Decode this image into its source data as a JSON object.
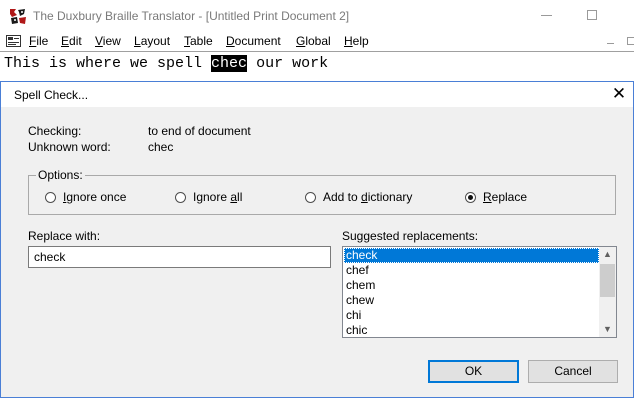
{
  "window": {
    "title": "The Duxbury Braille Translator - [Untitled Print Document 2]"
  },
  "menu": [
    {
      "label": "File",
      "underline": "F",
      "rest": "ile"
    },
    {
      "label": "Edit",
      "underline": "E",
      "rest": "dit"
    },
    {
      "label": "View",
      "underline": "V",
      "rest": "iew"
    },
    {
      "label": "Layout",
      "underline": "L",
      "rest": "ayout"
    },
    {
      "label": "Table",
      "underline": "T",
      "rest": "able"
    },
    {
      "label": "Document",
      "underline": "D",
      "rest": "ocument"
    },
    {
      "label": "Global",
      "underline": "G",
      "rest": "lobal"
    },
    {
      "label": "Help",
      "underline": "H",
      "rest": "elp"
    }
  ],
  "document": {
    "before": "This is where we spell ",
    "highlighted": "chec",
    "after": " our work"
  },
  "dialog": {
    "title": "Spell Check...",
    "checking_label": "Checking:",
    "checking_value": "to end of document",
    "unknown_label": "Unknown word:",
    "unknown_value": "chec",
    "options_label": "Options:",
    "options": [
      {
        "pre": "",
        "key": "I",
        "post": "gnore once",
        "checked": false
      },
      {
        "pre": "Ignore ",
        "key": "a",
        "post": "ll",
        "checked": false
      },
      {
        "pre": "Add to ",
        "key": "d",
        "post": "ictionary",
        "checked": false
      },
      {
        "pre": "",
        "key": "R",
        "post": "eplace",
        "checked": true
      }
    ],
    "replace_with_label": "Replace with:",
    "replace_with_value": "check",
    "suggested_label": "Suggested replacements:",
    "suggestions": [
      "check",
      "chef",
      "chem",
      "chew",
      "chi",
      "chic"
    ],
    "selected_suggestion": "check",
    "ok_label": "OK",
    "cancel_label": "Cancel"
  },
  "colors": {
    "selection": "#0078d7",
    "dialog_bg": "#f0f0f0",
    "dialog_border": "#4a7fd6"
  }
}
